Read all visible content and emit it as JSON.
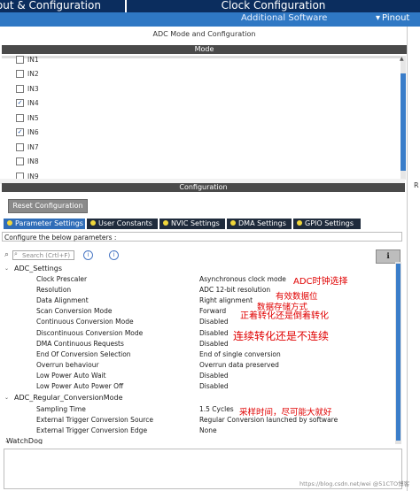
{
  "top_tabs": {
    "pinout_config": "Pinout & Configuration",
    "clock_config": "Clock Configuration"
  },
  "subbar": {
    "additional_software": "Additional Software",
    "pinout_menu": "Pinout",
    "pinout_menu_icon": "chevron-down-icon"
  },
  "panel": {
    "title": "ADC Mode and Configuration",
    "mode_header": "Mode",
    "mode_items": [
      {
        "label": "IN1",
        "checked": false
      },
      {
        "label": "IN2",
        "checked": false
      },
      {
        "label": "IN3",
        "checked": false
      },
      {
        "label": "IN4",
        "checked": true
      },
      {
        "label": "IN5",
        "checked": false
      },
      {
        "label": "IN6",
        "checked": true
      },
      {
        "label": "IN7",
        "checked": false
      },
      {
        "label": "IN8",
        "checked": false
      },
      {
        "label": "IN9",
        "checked": false
      }
    ],
    "config_header": "Configuration",
    "reset_button": "Reset Configuration",
    "tabs": [
      {
        "label": "Parameter Settings",
        "active": true
      },
      {
        "label": "User Constants",
        "active": false
      },
      {
        "label": "NVIC Settings",
        "active": false
      },
      {
        "label": "DMA Settings",
        "active": false
      },
      {
        "label": "GPIO Settings",
        "active": false
      }
    ],
    "configure_text": "Configure the below parameters :",
    "search_placeholder": "Search (Crtl+F)",
    "groups": {
      "adc_settings": "ADC_Settings",
      "regular_conversion": "ADC_Regular_ConversionMode",
      "watchdog": "WatchDog"
    },
    "adc_settings": [
      {
        "name": "Clock Prescaler",
        "value": "Asynchronous clock mode"
      },
      {
        "name": "Resolution",
        "value": "ADC 12-bit resolution"
      },
      {
        "name": "Data Alignment",
        "value": "Right alignment"
      },
      {
        "name": "Scan Conversion Mode",
        "value": "Forward"
      },
      {
        "name": "Continuous Conversion Mode",
        "value": "Disabled"
      },
      {
        "name": "Discontinuous Conversion Mode",
        "value": "Disabled"
      },
      {
        "name": "DMA Continuous Requests",
        "value": "Disabled"
      },
      {
        "name": "End Of Conversion Selection",
        "value": "End of single conversion"
      },
      {
        "name": "Overrun behaviour",
        "value": "Overrun data preserved"
      },
      {
        "name": "Low Power Auto Wait",
        "value": "Disabled"
      },
      {
        "name": "Low Power Auto Power Off",
        "value": "Disabled"
      }
    ],
    "regular_conversion": [
      {
        "name": "Sampling Time",
        "value": "1.5 Cycles"
      },
      {
        "name": "External Trigger Conversion Source",
        "value": "Regular Conversion launched by software"
      },
      {
        "name": "External Trigger Conversion Edge",
        "value": "None"
      }
    ]
  },
  "annotations": {
    "clock": "ADC时钟选择",
    "resolution": "有效数据位",
    "alignment": "数据存储方式",
    "scan": "正着转化还是倒着转化",
    "continuous": "连续转化还是不连续",
    "sampling": "采样时间，尽可能大就好"
  },
  "right_edge_letter": "R",
  "watermark": "https://blog.csdn.net/wei @51CTO博客"
}
